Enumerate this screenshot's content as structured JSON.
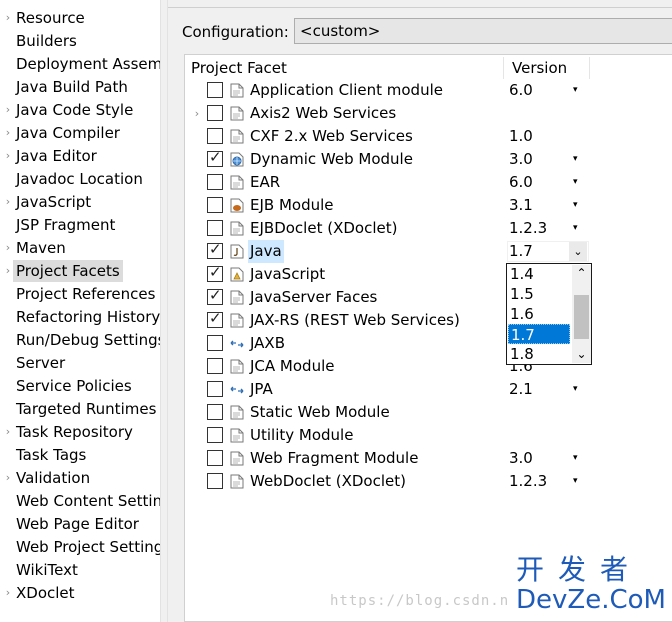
{
  "nav": {
    "items": [
      {
        "label": "Resource",
        "expandable": true
      },
      {
        "label": "Builders",
        "expandable": false
      },
      {
        "label": "Deployment Assem",
        "expandable": false
      },
      {
        "label": "Java Build Path",
        "expandable": false
      },
      {
        "label": "Java Code Style",
        "expandable": true
      },
      {
        "label": "Java Compiler",
        "expandable": true
      },
      {
        "label": "Java Editor",
        "expandable": true
      },
      {
        "label": "Javadoc Location",
        "expandable": false
      },
      {
        "label": "JavaScript",
        "expandable": true
      },
      {
        "label": "JSP Fragment",
        "expandable": false
      },
      {
        "label": "Maven",
        "expandable": true
      },
      {
        "label": "Project Facets",
        "expandable": true,
        "selected": true
      },
      {
        "label": "Project References",
        "expandable": false
      },
      {
        "label": "Refactoring History",
        "expandable": false
      },
      {
        "label": "Run/Debug Settings",
        "expandable": false
      },
      {
        "label": "Server",
        "expandable": false
      },
      {
        "label": "Service Policies",
        "expandable": false
      },
      {
        "label": "Targeted Runtimes",
        "expandable": false
      },
      {
        "label": "Task Repository",
        "expandable": true
      },
      {
        "label": "Task Tags",
        "expandable": false
      },
      {
        "label": "Validation",
        "expandable": true
      },
      {
        "label": "Web Content Settings",
        "expandable": false
      },
      {
        "label": "Web Page Editor",
        "expandable": false
      },
      {
        "label": "Web Project Settings",
        "expandable": false
      },
      {
        "label": "WikiText",
        "expandable": false
      },
      {
        "label": "XDoclet",
        "expandable": true
      }
    ]
  },
  "config": {
    "label": "Configuration:",
    "value": "<custom>"
  },
  "table": {
    "col_facet": "Project Facet",
    "col_version": "Version",
    "rows": [
      {
        "name": "Application Client module",
        "checked": false,
        "icon": "page-icon",
        "version": "6.0",
        "has_dropdown": true,
        "expandable": false
      },
      {
        "name": "Axis2 Web Services",
        "checked": false,
        "icon": "page-icon",
        "version": "",
        "has_dropdown": false,
        "expandable": true
      },
      {
        "name": "CXF 2.x Web Services",
        "checked": false,
        "icon": "page-icon",
        "version": "1.0",
        "has_dropdown": false,
        "expandable": false
      },
      {
        "name": "Dynamic Web Module",
        "checked": true,
        "icon": "globe-icon",
        "version": "3.0",
        "has_dropdown": true,
        "expandable": false
      },
      {
        "name": "EAR",
        "checked": false,
        "icon": "page-icon",
        "version": "6.0",
        "has_dropdown": true,
        "expandable": false
      },
      {
        "name": "EJB Module",
        "checked": false,
        "icon": "bean-icon",
        "version": "3.1",
        "has_dropdown": true,
        "expandable": false
      },
      {
        "name": "EJBDoclet (XDoclet)",
        "checked": false,
        "icon": "page-icon",
        "version": "1.2.3",
        "has_dropdown": true,
        "expandable": false
      },
      {
        "name": "Java",
        "checked": true,
        "icon": "java-icon",
        "version": "1.7",
        "has_dropdown": true,
        "expandable": false,
        "selected": true
      },
      {
        "name": "JavaScript",
        "checked": true,
        "icon": "js-icon",
        "version": "",
        "has_dropdown": false,
        "expandable": false
      },
      {
        "name": "JavaServer Faces",
        "checked": true,
        "icon": "page-icon",
        "version": "",
        "has_dropdown": false,
        "expandable": false
      },
      {
        "name": "JAX-RS (REST Web Services)",
        "checked": true,
        "icon": "page-icon",
        "version": "",
        "has_dropdown": false,
        "expandable": false
      },
      {
        "name": "JAXB",
        "checked": false,
        "icon": "arrows-icon",
        "version": "",
        "has_dropdown": false,
        "expandable": false
      },
      {
        "name": "JCA Module",
        "checked": false,
        "icon": "page-icon",
        "version": "1.6",
        "has_dropdown": false,
        "expandable": false
      },
      {
        "name": "JPA",
        "checked": false,
        "icon": "arrows-icon",
        "version": "2.1",
        "has_dropdown": true,
        "expandable": false
      },
      {
        "name": "Static Web Module",
        "checked": false,
        "icon": "page-icon",
        "version": "",
        "has_dropdown": false,
        "expandable": false
      },
      {
        "name": "Utility Module",
        "checked": false,
        "icon": "page-icon",
        "version": "",
        "has_dropdown": false,
        "expandable": false
      },
      {
        "name": "Web Fragment Module",
        "checked": false,
        "icon": "page-icon",
        "version": "3.0",
        "has_dropdown": true,
        "expandable": false
      },
      {
        "name": "WebDoclet (XDoclet)",
        "checked": false,
        "icon": "page-icon",
        "version": "1.2.3",
        "has_dropdown": true,
        "expandable": false
      }
    ]
  },
  "version_dropdown": {
    "options": [
      "1.4",
      "1.5",
      "1.6",
      "1.7",
      "1.8"
    ],
    "selected": "1.7"
  },
  "watermark": {
    "url": "https://blog.csdn.n",
    "brand_cn": "开发者",
    "brand_en": "DevZe.CoM"
  },
  "colors": {
    "selection": "#0078d7",
    "row_highlight": "#cde8ff",
    "brand": "#1e5bb8"
  }
}
